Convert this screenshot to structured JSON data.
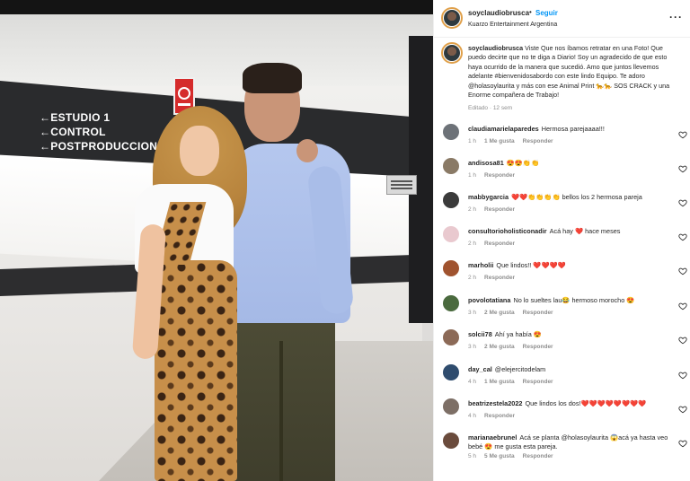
{
  "photo": {
    "signs": [
      "←ESTUDIO 1",
      "←CONTROL",
      "←POSTPRODUCCION"
    ]
  },
  "post": {
    "username": "soyclaudiobrusca",
    "separator": "•",
    "follow_label": "Seguir",
    "subtitle": "Kuarzo Entertainment Argentina",
    "more_icon": "more-horizontal-icon",
    "more_label": "···"
  },
  "caption": {
    "username": "soyclaudiobrusca",
    "text": "Viste Que nos íbamos retratar en una Foto! Que puedo decirte que no te diga a Diario! Soy un agradecido de que esto haya ocurrido de la manera que sucedió. Amo que juntos llevemos adelante #bienvenidosabordo con este lindo Equipo. Te adoro @holasoylaurita y más con ese Animal Print 🐆🐆 SOS CRACK y una Enorme compañera de Trabajo!",
    "meta": "Editado · 12 sem"
  },
  "comments": [
    {
      "user": "claudiamarielaparedes",
      "text": "Hermosa parejaaaa!!!",
      "time": "1 h",
      "likes": "1 Me gusta",
      "reply": "Responder",
      "avatar_color": "#6d7278"
    },
    {
      "user": "andisosa81",
      "text": "😍😍👏👏",
      "time": "1 h",
      "likes": "",
      "reply": "Responder",
      "avatar_color": "#8a7a66"
    },
    {
      "user": "mabbygarcia",
      "text": "❤️❤️👏👏👏👏 bellos los 2 hermosa pareja",
      "time": "2 h",
      "likes": "",
      "reply": "Responder",
      "avatar_color": "#3b3b3b"
    },
    {
      "user": "consultorioholisticonadir",
      "text": "Acá hay ❤️ hace meses",
      "time": "2 h",
      "likes": "",
      "reply": "Responder",
      "avatar_color": "#e9c9cf"
    },
    {
      "user": "marholii",
      "text": "Que lindos!! ❤️❤️❤️❤️",
      "time": "2 h",
      "likes": "",
      "reply": "Responder",
      "avatar_color": "#a0532f"
    },
    {
      "user": "povolotatiana",
      "text": "No lo sueltes lau😂 hermoso morocho 😍",
      "time": "3 h",
      "likes": "2 Me gusta",
      "reply": "Responder",
      "avatar_color": "#4a6a3e"
    },
    {
      "user": "solcii78",
      "text": "Ahí ya había 😍",
      "time": "3 h",
      "likes": "2 Me gusta",
      "reply": "Responder",
      "avatar_color": "#8c6a57"
    },
    {
      "user": "day_cal",
      "text": "@elejercitodelam",
      "time": "4 h",
      "likes": "1 Me gusta",
      "reply": "Responder",
      "avatar_color": "#2f4c6e"
    },
    {
      "user": "beatrizestela2022",
      "text": "Que lindos los dos!❤️❤️❤️❤️❤️❤️❤️❤️",
      "time": "4 h",
      "likes": "",
      "reply": "Responder",
      "avatar_color": "#7d6f66"
    },
    {
      "user": "marianaebrunel",
      "text": "Acá se planta @holasoylaurita 😱acá ya hasta veo bebé 😍 me gusta esta pareja.",
      "time": "5 h",
      "likes": "5 Me gusta",
      "reply": "Responder",
      "avatar_color": "#6a4b3c"
    }
  ],
  "icons": {
    "like": "heart-outline-icon"
  },
  "colors": {
    "link_blue": "#0095f6",
    "meta_gray": "#8e8e8e",
    "text": "#262626"
  }
}
